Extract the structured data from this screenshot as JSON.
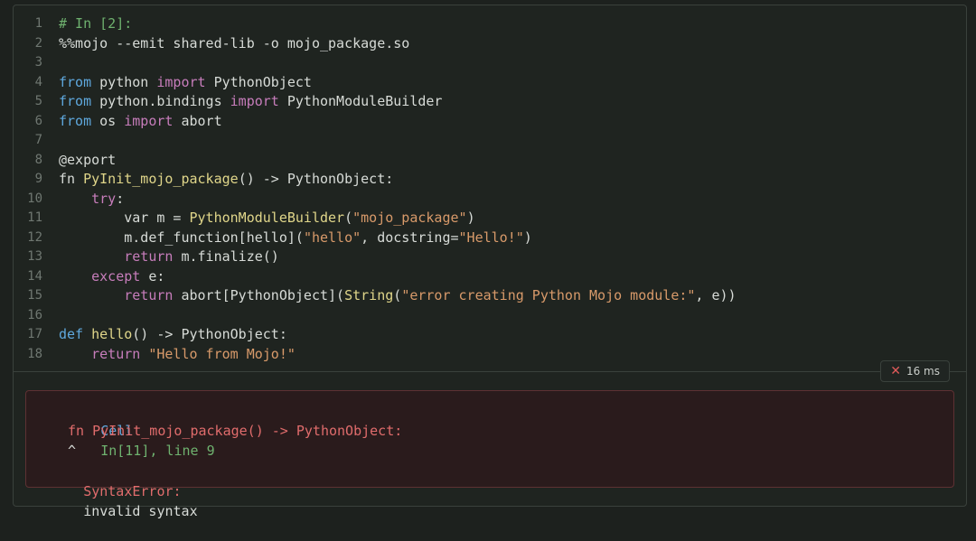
{
  "code_lines": [
    [
      {
        "t": "# In [2]:",
        "c": "t-cm"
      }
    ],
    [
      {
        "t": "%%mojo --emit shared-lib -o mojo_package.so",
        "c": "t-pl"
      }
    ],
    [],
    [
      {
        "t": "from",
        "c": "t-bl"
      },
      {
        "t": " python ",
        "c": "t-pl"
      },
      {
        "t": "import",
        "c": "t-kw"
      },
      {
        "t": " PythonObject",
        "c": "t-pl"
      }
    ],
    [
      {
        "t": "from",
        "c": "t-bl"
      },
      {
        "t": " python.bindings ",
        "c": "t-pl"
      },
      {
        "t": "import",
        "c": "t-kw"
      },
      {
        "t": " PythonModuleBuilder",
        "c": "t-pl"
      }
    ],
    [
      {
        "t": "from",
        "c": "t-bl"
      },
      {
        "t": " os ",
        "c": "t-pl"
      },
      {
        "t": "import",
        "c": "t-kw"
      },
      {
        "t": " abort",
        "c": "t-pl"
      }
    ],
    [],
    [
      {
        "t": "@export",
        "c": "t-pl"
      }
    ],
    [
      {
        "t": "fn ",
        "c": "t-pl"
      },
      {
        "t": "PyInit_mojo_package",
        "c": "t-fn"
      },
      {
        "t": "() -> PythonObject:",
        "c": "t-pl"
      }
    ],
    [
      {
        "t": "    ",
        "c": "t-pl"
      },
      {
        "t": "try",
        "c": "t-kw"
      },
      {
        "t": ":",
        "c": "t-pl"
      }
    ],
    [
      {
        "t": "        var m = ",
        "c": "t-pl"
      },
      {
        "t": "PythonModuleBuilder",
        "c": "t-fn"
      },
      {
        "t": "(",
        "c": "t-pl"
      },
      {
        "t": "\"mojo_package\"",
        "c": "t-st"
      },
      {
        "t": ")",
        "c": "t-pl"
      }
    ],
    [
      {
        "t": "        m.def_function[hello](",
        "c": "t-pl"
      },
      {
        "t": "\"hello\"",
        "c": "t-st"
      },
      {
        "t": ", docstring=",
        "c": "t-pl"
      },
      {
        "t": "\"Hello!\"",
        "c": "t-st"
      },
      {
        "t": ")",
        "c": "t-pl"
      }
    ],
    [
      {
        "t": "        ",
        "c": "t-pl"
      },
      {
        "t": "return",
        "c": "t-kw"
      },
      {
        "t": " m.finalize()",
        "c": "t-pl"
      }
    ],
    [
      {
        "t": "    ",
        "c": "t-pl"
      },
      {
        "t": "except",
        "c": "t-kw"
      },
      {
        "t": " e:",
        "c": "t-pl"
      }
    ],
    [
      {
        "t": "        ",
        "c": "t-pl"
      },
      {
        "t": "return",
        "c": "t-kw"
      },
      {
        "t": " abort[PythonObject](",
        "c": "t-pl"
      },
      {
        "t": "String",
        "c": "t-fn"
      },
      {
        "t": "(",
        "c": "t-pl"
      },
      {
        "t": "\"error creating Python Mojo module:\"",
        "c": "t-st"
      },
      {
        "t": ", e))",
        "c": "t-pl"
      }
    ],
    [],
    [
      {
        "t": "def",
        "c": "t-bl"
      },
      {
        "t": " ",
        "c": "t-pl"
      },
      {
        "t": "hello",
        "c": "t-fn"
      },
      {
        "t": "() -> PythonObject:",
        "c": "t-pl"
      }
    ],
    [
      {
        "t": "    ",
        "c": "t-pl"
      },
      {
        "t": "return",
        "c": "t-kw"
      },
      {
        "t": " ",
        "c": "t-pl"
      },
      {
        "t": "\"Hello from Mojo!\"",
        "c": "t-st"
      }
    ]
  ],
  "timing": {
    "label": "16 ms",
    "icon": "close-x-icon",
    "color": "#e05a5a"
  },
  "output": {
    "cell_word": "Cell",
    "cell_ref": "In[11], line 9",
    "error_code": "fn PyInit_mojo_package() -> PythonObject:",
    "caret": "^",
    "error_type": "SyntaxError:",
    "error_message": "invalid syntax"
  }
}
